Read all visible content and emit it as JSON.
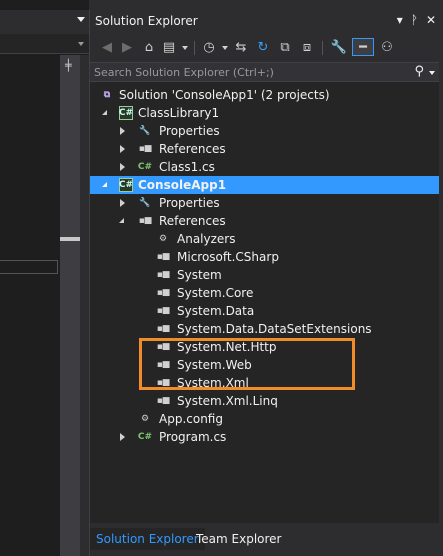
{
  "panel": {
    "title": "Solution Explorer",
    "title_buttons": [
      "▾",
      "ᚹ",
      "✕"
    ],
    "search_placeholder": "Search Solution Explorer (Ctrl+;)"
  },
  "tree": [
    {
      "label": "Solution 'ConsoleApp1' (2 projects)",
      "icon": "solution-icon",
      "glyph": "⧉"
    },
    {
      "label": "ClassLibrary1",
      "icon": "csharp-project-icon",
      "glyph": "C#"
    },
    {
      "label": "Properties",
      "icon": "wrench-icon",
      "glyph": "🔧"
    },
    {
      "label": "References",
      "icon": "reference-icon",
      "glyph": "▪■"
    },
    {
      "label": "Class1.cs",
      "icon": "csharp-file-icon",
      "glyph": "C#"
    },
    {
      "label": "ConsoleApp1",
      "icon": "csharp-project-icon",
      "glyph": "C#"
    },
    {
      "label": "Properties",
      "icon": "wrench-icon",
      "glyph": "🔧"
    },
    {
      "label": "References",
      "icon": "reference-icon",
      "glyph": "▪■"
    },
    {
      "label": "Analyzers",
      "icon": "analyzer-icon",
      "glyph": "⚙"
    },
    {
      "label": "Microsoft.CSharp",
      "icon": "reference-icon",
      "glyph": "▪■"
    },
    {
      "label": "System",
      "icon": "reference-icon",
      "glyph": "▪■"
    },
    {
      "label": "System.Core",
      "icon": "reference-icon",
      "glyph": "▪■"
    },
    {
      "label": "System.Data",
      "icon": "reference-icon",
      "glyph": "▪■"
    },
    {
      "label": "System.Data.DataSetExtensions",
      "icon": "reference-icon",
      "glyph": "▪■"
    },
    {
      "label": "System.Net.Http",
      "icon": "reference-icon",
      "glyph": "▪■"
    },
    {
      "label": "System.Web",
      "icon": "reference-icon",
      "glyph": "▪■"
    },
    {
      "label": "System.Xml",
      "icon": "reference-icon",
      "glyph": "▪■"
    },
    {
      "label": "System.Xml.Linq",
      "icon": "reference-icon",
      "glyph": "▪■"
    },
    {
      "label": "App.config",
      "icon": "config-file-icon",
      "glyph": "⚙"
    },
    {
      "label": "Program.cs",
      "icon": "csharp-file-icon",
      "glyph": "C#"
    }
  ],
  "tabs": [
    "Solution Explorer",
    "Team Explorer"
  ],
  "colors": {
    "selection": "#3399ff",
    "highlight_box": "#f28c28",
    "panel_bg": "#252526"
  }
}
